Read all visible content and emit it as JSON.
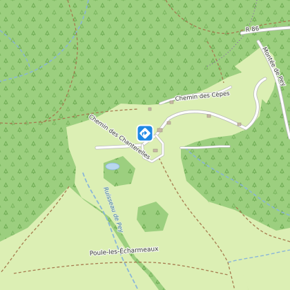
{
  "map": {
    "labels": {
      "road_r86": "R 86",
      "chemin_des_cepes": "Chemin des Cèpes",
      "chemin_des_chanterelles": "Chemin des Chanterelles",
      "montee_de_pey": "Montée de Pey",
      "ruisseau_de_pey": "Ruisseau de Pey",
      "poule_les_echarmeaux": "Poule-les-Écharmeaux"
    },
    "marker": {
      "icon": "directions-diamond-icon",
      "color": "#1e88e5"
    },
    "colors": {
      "forest": "#9ccf7f",
      "meadow": "#dcefb4",
      "road": "#ffffff",
      "road_casing": "#b9b9b9",
      "track": "#a57a4e",
      "boundary": "#8a5bb0",
      "stream": "#8ab6d8",
      "water": "#b8d7ee"
    }
  }
}
